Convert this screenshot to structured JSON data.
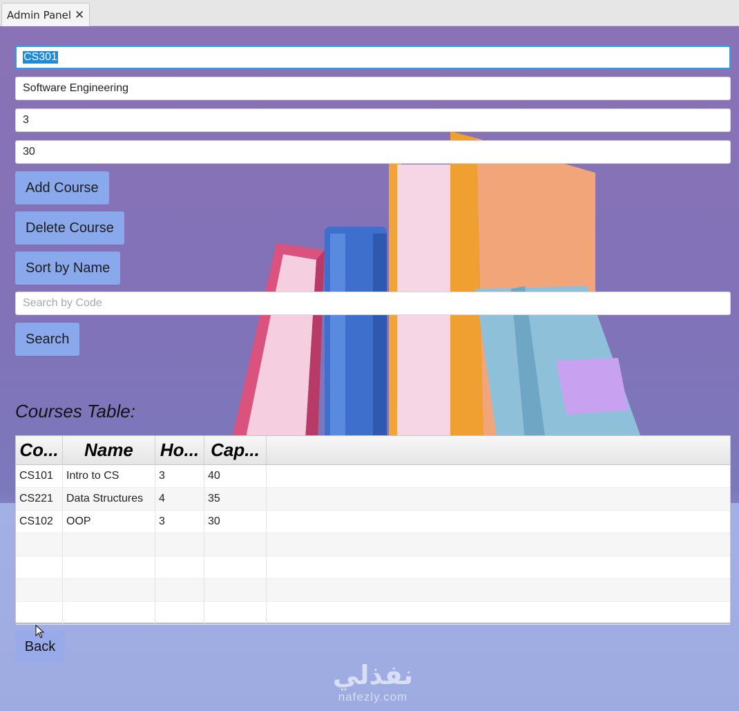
{
  "window": {
    "tab_title": "Admin Panel",
    "close_glyph": "✕"
  },
  "form": {
    "code_value": "CS301",
    "name_value": "Software Engineering",
    "hours_value": "3",
    "capacity_value": "30",
    "search_placeholder": "Search by Code"
  },
  "buttons": {
    "add": "Add Course",
    "delete": "Delete Course",
    "sort": "Sort by Name",
    "search": "Search",
    "back": "Back"
  },
  "table": {
    "title": "Courses Table:",
    "columns": [
      "Co...",
      "Name",
      "Ho...",
      "Cap..."
    ],
    "rows": [
      [
        "CS101",
        "Intro to CS",
        "3",
        "40"
      ],
      [
        "CS221",
        "Data Structures",
        "4",
        "35"
      ],
      [
        "CS102",
        "OOP",
        "3",
        "30"
      ],
      [
        "",
        "",
        "",
        ""
      ],
      [
        "",
        "",
        "",
        ""
      ],
      [
        "",
        "",
        "",
        ""
      ],
      [
        "",
        "",
        "",
        ""
      ]
    ]
  },
  "watermark": {
    "arabic": "نفذلي",
    "latin": "nafezly.com"
  },
  "icons": {
    "cursor": "mouse-pointer-icon",
    "tab_close": "close-icon"
  },
  "colors": {
    "button_bg": "#8aa8ec",
    "focus_border": "#2a9ee8",
    "selection": "#1f8bd8"
  }
}
